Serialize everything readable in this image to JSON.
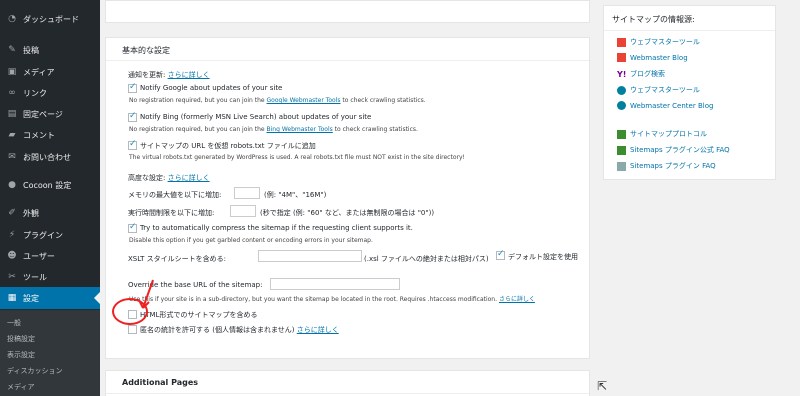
{
  "sidebar": {
    "items": [
      {
        "label": "ダッシュボード",
        "icon": "dashboard-icon"
      },
      {
        "label": "投稿",
        "icon": "pin-icon"
      },
      {
        "label": "メディア",
        "icon": "media-icon"
      },
      {
        "label": "リンク",
        "icon": "link-icon"
      },
      {
        "label": "固定ページ",
        "icon": "page-icon"
      },
      {
        "label": "コメント",
        "icon": "comment-icon"
      },
      {
        "label": "お問い合わせ",
        "icon": "mail-icon"
      },
      {
        "label": "Cocoon 設定",
        "icon": "cocoon-icon"
      },
      {
        "label": "外観",
        "icon": "brush-icon"
      },
      {
        "label": "プラグイン",
        "icon": "plugin-icon"
      },
      {
        "label": "ユーザー",
        "icon": "user-icon"
      },
      {
        "label": "ツール",
        "icon": "wrench-icon"
      },
      {
        "label": "設定",
        "icon": "settings-icon"
      }
    ],
    "submenu": [
      "一般",
      "投稿設定",
      "表示設定",
      "ディスカッション",
      "メディア"
    ]
  },
  "settings": {
    "title": "基本的な設定",
    "notify_label": "通知を更新:",
    "more_link": "さらに詳しく",
    "google_notify": "Notify Google about updates of your site",
    "google_desc_pre": "No registration required, but you can join the ",
    "google_desc_link": "Google Webmaster Tools",
    "google_desc_post": " to check crawling statistics.",
    "bing_notify": "Notify Bing (formerly MSN Live Search) about updates of your site",
    "bing_desc_pre": "No registration required, but you can join the ",
    "bing_desc_link": "Bing Webmaster Tools",
    "bing_desc_post": " to check crawling statistics.",
    "robots_label": "サイトマップの URL を仮想 robots.txt ファイルに追加",
    "robots_desc": "The virtual robots.txt generated by WordPress is used. A real robots.txt file must NOT exist in the site directory!",
    "advanced_label": "高度な設定:",
    "memory_label": "メモリの最大値を以下に増加:",
    "memory_hint": "(例: \"4M\"、\"16M\")",
    "time_label": "実行時間制限を以下に増加:",
    "time_hint": "(秒で指定 (例: \"60\" など、または無制限の場合は \"0\"))",
    "compress_label": "Try to automatically compress the sitemap if the requesting client supports it.",
    "compress_desc": "Disable this option if you get garbled content or encoding errors in your sitemap.",
    "xslt_label": "XSLT スタイルシートを含める:",
    "xslt_hint": "(.xsl ファイルへの絶対または相対パス)",
    "xslt_default": "デフォルト設定を使用",
    "override_label": "Override the base URL of the sitemap:",
    "override_desc": "Use this if your site is in a sub-directory, but you want the sitemap be located in the root. Requires .htaccess modification.",
    "html_label": "HTML形式でのサイトマップを含める",
    "anon_label": "匿名の統計を許可する (個人情報は含まれません)"
  },
  "pages_panel": {
    "title": "Additional Pages"
  },
  "info_panel": {
    "title": "サイトマップの情報源:",
    "links": [
      {
        "label": "ウェブマスターツール",
        "icon": "google-icon",
        "color": "#d93025"
      },
      {
        "label": "Webmaster Blog",
        "icon": "google-icon",
        "color": "#d93025"
      },
      {
        "label": "ブログ検索",
        "icon": "yahoo-icon",
        "color": "#7b0099"
      },
      {
        "label": "ウェブマスターツール",
        "icon": "bing-icon",
        "color": "#00809d"
      },
      {
        "label": "Webmaster Center Blog",
        "icon": "bing-icon",
        "color": "#00809d"
      },
      {
        "label": "サイトマッププロトコル",
        "icon": "sitemap-icon",
        "color": "#3c8d2f"
      },
      {
        "label": "Sitemaps プラグイン公式 FAQ",
        "icon": "sitemap-icon",
        "color": "#3c8d2f"
      },
      {
        "label": "Sitemaps プラグイン FAQ",
        "icon": "sitemap-icon",
        "color": "#8aa"
      }
    ]
  },
  "colors": {
    "accent": "#0073aa",
    "sidebar": "#23282d",
    "annotation": "#e22222"
  }
}
